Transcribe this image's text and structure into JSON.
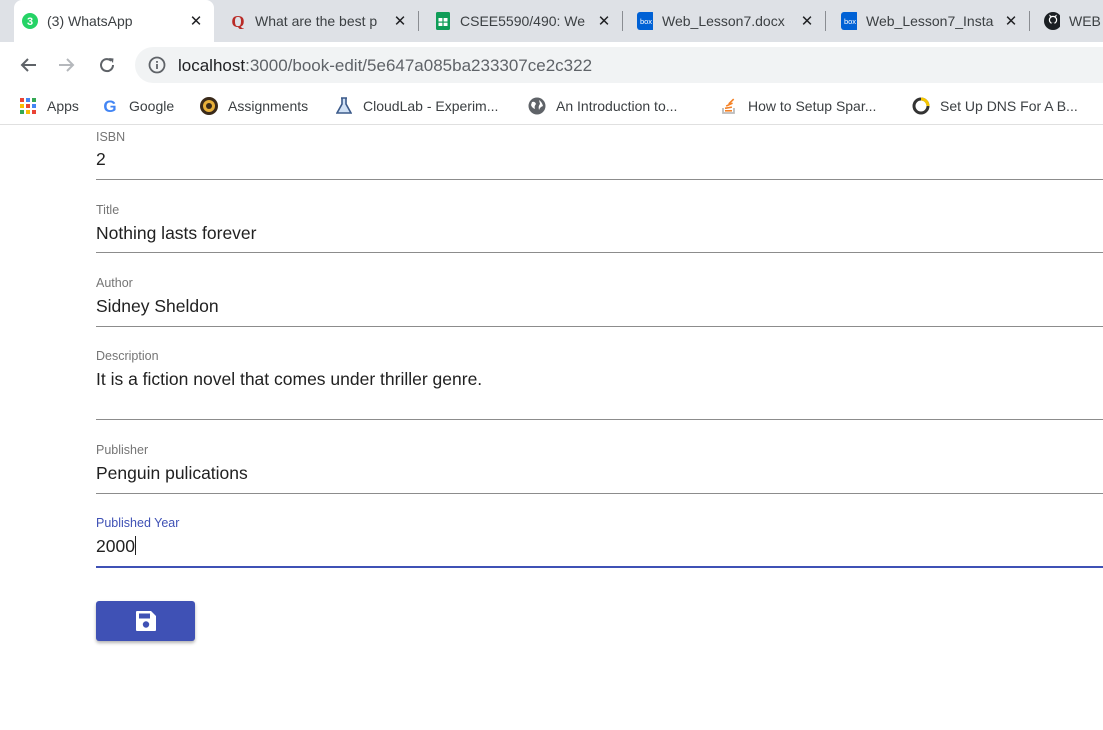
{
  "browser": {
    "tabs": [
      {
        "title": "(3) WhatsApp",
        "icon": "whatsapp-icon",
        "badge": "3",
        "active": true
      },
      {
        "title": "What are the best p",
        "icon": "quora-icon"
      },
      {
        "title": "CSEE5590/490: We",
        "icon": "google-sheets-icon"
      },
      {
        "title": "Web_Lesson7.docx",
        "icon": "box-icon",
        "icon_text": "box"
      },
      {
        "title": "Web_Lesson7_Insta",
        "icon": "box-icon",
        "icon_text": "box"
      },
      {
        "title": "WEB",
        "icon": "github-icon"
      }
    ],
    "url_host": "localhost",
    "url_path": ":3000/book-edit/5e647a085ba233307ce2c322",
    "bookmarks": [
      {
        "label": "Apps",
        "icon": "apps-grid-icon"
      },
      {
        "label": "Google",
        "icon": "google-icon",
        "icon_text": "G"
      },
      {
        "label": "Assignments",
        "icon": "assignments-icon"
      },
      {
        "label": "CloudLab - Experim...",
        "icon": "flask-icon"
      },
      {
        "label": "An Introduction to...",
        "icon": "globe-icon"
      },
      {
        "label": "How to Setup Spar...",
        "icon": "stackoverflow-icon"
      },
      {
        "label": "Set Up DNS For A B...",
        "icon": "dns-icon"
      }
    ]
  },
  "form": {
    "fields": [
      {
        "label": "ISBN",
        "value": "2"
      },
      {
        "label": "Title",
        "value": "Nothing lasts forever"
      },
      {
        "label": "Author",
        "value": "Sidney Sheldon"
      },
      {
        "label": "Description",
        "value": "It is a fiction novel that comes under thriller genre."
      },
      {
        "label": "Publisher",
        "value": "Penguin pulications"
      },
      {
        "label": "Published Year",
        "value": "2000",
        "focused": true
      }
    ],
    "save_icon": "save-icon"
  },
  "colors": {
    "primary": "#3f51b5",
    "tab_strip": "#dee1e6",
    "whatsapp": "#25d366",
    "quora": "#b92b27",
    "sheets": "#0f9d58",
    "box": "#0061d5"
  }
}
